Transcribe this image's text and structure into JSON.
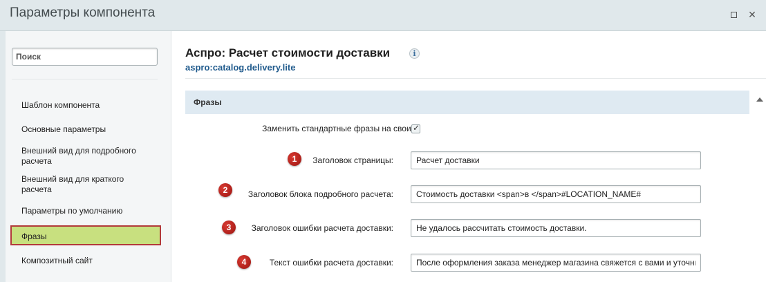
{
  "window": {
    "title": "Параметры компонента"
  },
  "sidebar": {
    "search_placeholder": "Поиск",
    "items": [
      {
        "label": "Шаблон компонента"
      },
      {
        "label": "Основные параметры"
      },
      {
        "label": "Внешний вид для подробного расчета"
      },
      {
        "label": "Внешний вид для краткого расчета"
      },
      {
        "label": "Параметры по умолчанию"
      },
      {
        "label": "Фразы",
        "active": true
      },
      {
        "label": "Композитный сайт"
      }
    ]
  },
  "component": {
    "title": "Аспро: Расчет стоимости доставки",
    "code": "aspro:catalog.delivery.lite",
    "info_icon": "i"
  },
  "section": {
    "title": "Фразы"
  },
  "form": {
    "replace_label": "Заменить стандартные фразы на свои:",
    "replace_checked": true,
    "fields": [
      {
        "badge": "1",
        "label": "Заголовок страницы:",
        "value": "Расчет доставки"
      },
      {
        "badge": "2",
        "label": "Заголовок блока подробного расчета:",
        "value": "Стоимость доставки <span>в </span>#LOCATION_NAME#"
      },
      {
        "badge": "3",
        "label": "Заголовок ошибки расчета доставки:",
        "value": "Не удалось рассчитать стоимость доставки."
      },
      {
        "badge": "4",
        "label": "Текст ошибки расчета доставки:",
        "value": "После оформления заказа менеджер магазина свяжется с вами и уточнит стоимость доставки"
      }
    ]
  },
  "colors": {
    "titlebar": "#e0e8eb",
    "active_item": "#c8e07f",
    "active_border": "#b23a3a",
    "badge": "#b8211b",
    "link": "#215b8d"
  }
}
